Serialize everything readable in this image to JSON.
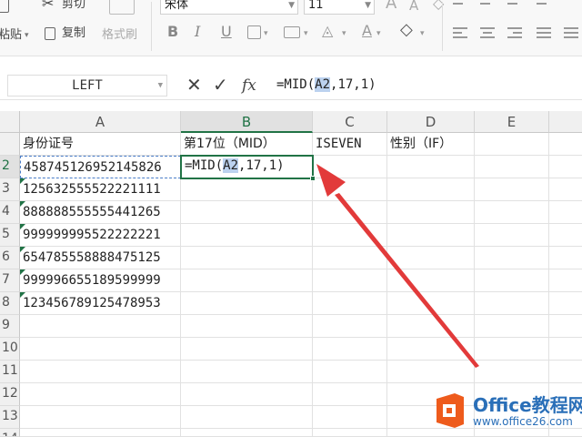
{
  "ribbon": {
    "cut_label": "剪切",
    "paste_label": "粘贴",
    "copy_label": "复制",
    "format_painter_label": "格式刷",
    "font_name": "宋体",
    "font_size": "11",
    "bold_glyph": "B",
    "italic_glyph": "I",
    "underline_glyph": "U",
    "font_color_glyph": "A"
  },
  "formula_bar": {
    "name_box": "LEFT",
    "cancel_glyph": "✕",
    "enter_glyph": "✓",
    "fx_label": "fx",
    "formula_prefix": "=MID(",
    "formula_ref": "A2",
    "formula_suffix": ",17,1)"
  },
  "sheet": {
    "columns": [
      "A",
      "B",
      "C",
      "D",
      "E"
    ],
    "selected_column": "B",
    "row_numbers": [
      "",
      "2",
      "3",
      "4",
      "5",
      "6",
      "7",
      "8",
      "9",
      "10",
      "11",
      "12",
      "13",
      "14"
    ],
    "headers": {
      "a": "身份证号",
      "b": "第17位（MID）",
      "c": "ISEVEN",
      "d": "性别（IF）"
    },
    "id_numbers": [
      "458745126952145826",
      "125632555522221111",
      "888888555555441265",
      "999999995522222221",
      "654785558888475125",
      "999996655189599999",
      "123456789125478953"
    ],
    "editing_cell": {
      "prefix": "=MID(",
      "ref": "A2",
      "suffix": ",17,1)"
    }
  },
  "annotation": {
    "arrow_color": "#e23a3a"
  },
  "watermark": {
    "title": "Office教程网",
    "url": "www.office26.com"
  },
  "colors": {
    "accent_green": "#217346",
    "reference_highlight": "#bcd2ef",
    "logo_orange": "#ee5b1c",
    "logo_blue": "#2a6fb8"
  }
}
